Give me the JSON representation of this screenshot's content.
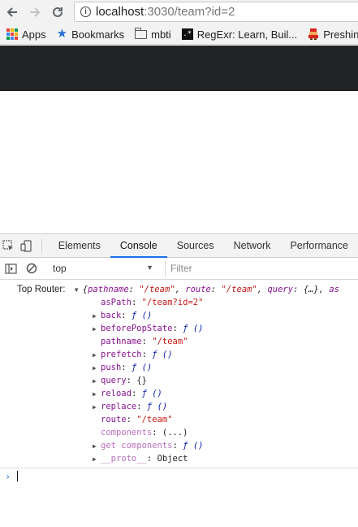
{
  "browser": {
    "url_host": "localhost",
    "url_rest": ":3030/team?id=2",
    "bookmarks": [
      {
        "label": "Apps",
        "icon": "apps-grid-icon"
      },
      {
        "label": "Bookmarks",
        "icon": "star-icon"
      },
      {
        "label": "mbti",
        "icon": "folder-icon"
      },
      {
        "label": "RegExr: Learn, Buil...",
        "icon": "regexr-icon"
      },
      {
        "label": "Preshin",
        "icon": "pixel-character-icon"
      }
    ]
  },
  "devtools": {
    "tabs": [
      "Elements",
      "Console",
      "Sources",
      "Network",
      "Performance"
    ],
    "active_tab": "Console",
    "context": "top",
    "filter_placeholder": "Filter",
    "log": {
      "prefix": "Top Router:",
      "summary_parts": {
        "open": "{",
        "pathname_key": "pathname",
        "pathname_val": "\"/team\"",
        "route_key": "route",
        "route_val": "\"/team\"",
        "query_key": "query",
        "query_val": "{…}",
        "tail": "as"
      },
      "props": [
        {
          "key": "asPath",
          "value": "\"/team?id=2\"",
          "kind": "string",
          "expandable": false,
          "dim": false
        },
        {
          "key": "back",
          "value": "ƒ ()",
          "kind": "function",
          "expandable": true,
          "dim": false
        },
        {
          "key": "beforePopState",
          "value": "ƒ ()",
          "kind": "function",
          "expandable": true,
          "dim": false
        },
        {
          "key": "pathname",
          "value": "\"/team\"",
          "kind": "string",
          "expandable": false,
          "dim": false
        },
        {
          "key": "prefetch",
          "value": "ƒ ()",
          "kind": "function",
          "expandable": true,
          "dim": false
        },
        {
          "key": "push",
          "value": "ƒ ()",
          "kind": "function",
          "expandable": true,
          "dim": false
        },
        {
          "key": "query",
          "value": "{}",
          "kind": "object",
          "expandable": true,
          "dim": false
        },
        {
          "key": "reload",
          "value": "ƒ ()",
          "kind": "function",
          "expandable": true,
          "dim": false
        },
        {
          "key": "replace",
          "value": "ƒ ()",
          "kind": "function",
          "expandable": true,
          "dim": false
        },
        {
          "key": "route",
          "value": "\"/team\"",
          "kind": "string",
          "expandable": false,
          "dim": false
        },
        {
          "key": "components",
          "value": "(...)",
          "kind": "object",
          "expandable": false,
          "dim": true
        },
        {
          "key": "get components",
          "value": "ƒ ()",
          "kind": "function",
          "expandable": true,
          "dim": true
        },
        {
          "key": "__proto__",
          "value": "Object",
          "kind": "object",
          "expandable": true,
          "dim": true
        }
      ]
    },
    "prompt_symbol": "›"
  },
  "colors": {
    "page_header": "#222325",
    "active_tab_underline": "#1a73e8",
    "console_key": "#881391",
    "console_string": "#c41a16",
    "console_function": "#0d22aa"
  }
}
